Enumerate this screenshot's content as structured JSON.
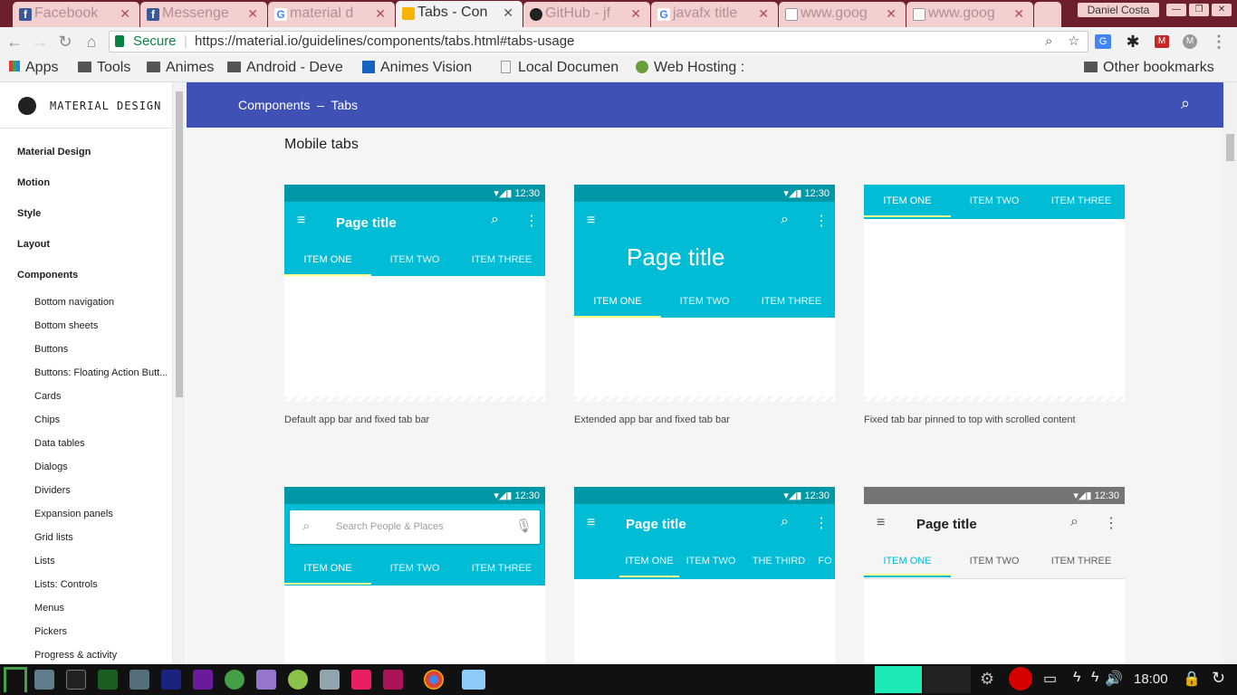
{
  "browser": {
    "tabs": [
      {
        "title": "Facebook"
      },
      {
        "title": "Messenge"
      },
      {
        "title": "material d"
      },
      {
        "title": "Tabs - Con"
      },
      {
        "title": "GitHub - jf"
      },
      {
        "title": "javafx title"
      },
      {
        "title": "www.goog"
      },
      {
        "title": "www.goog"
      }
    ],
    "profile": "Daniel Costa",
    "secure_label": "Secure",
    "url": "https://material.io/guidelines/components/tabs.html#tabs-usage",
    "bookmarks": [
      "Apps",
      "Tools",
      "Animes",
      "Android - Deve",
      "Animes Vision",
      "Local Documen",
      "Web Hosting :"
    ],
    "other_bookmarks": "Other bookmarks"
  },
  "sidebar": {
    "logo_text": "MATERIAL DESIGN",
    "sections": [
      "Material Design",
      "Motion",
      "Style",
      "Layout",
      "Components"
    ],
    "items": [
      "Bottom navigation",
      "Bottom sheets",
      "Buttons",
      "Buttons: Floating Action Butt...",
      "Cards",
      "Chips",
      "Data tables",
      "Dialogs",
      "Dividers",
      "Expansion panels",
      "Grid lists",
      "Lists",
      "Lists: Controls",
      "Menus",
      "Pickers",
      "Progress & activity"
    ]
  },
  "appbar": {
    "breadcrumb": "Components  –  Tabs"
  },
  "main": {
    "heading": "Mobile tabs",
    "time": "12:30",
    "page_title": "Page title",
    "tab1": "ITEM ONE",
    "tab2": "ITEM TWO",
    "tab3": "ITEM THREE",
    "tab_third": "THE THIRD",
    "tab_fo": "FO",
    "search_placeholder": "Search People  & Places",
    "captions": [
      "Default app bar and fixed tab bar",
      "Extended app bar and fixed tab bar",
      "Fixed tab bar pinned to top with scrolled content"
    ]
  },
  "taskbar": {
    "clock": "18:00"
  },
  "colors": {
    "appbar": "#3f51b5",
    "primary": "#00bcd4",
    "status": "#0097a7",
    "indicator": "#ffff8d"
  }
}
